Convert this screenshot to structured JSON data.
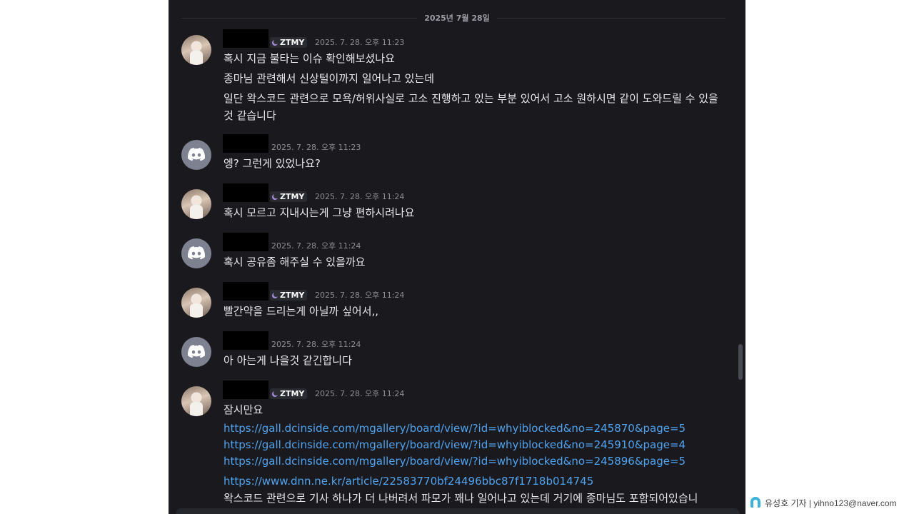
{
  "date_divider": "2025년 7월 28일",
  "messages": [
    {
      "avatar": "photo-avatar",
      "badge": "ZTMY",
      "timestamp": "2025. 7. 28. 오후 11:23",
      "lines": [
        "혹시 지금 불타는 이슈 확인해보셨나요",
        "종마님 관련해서 신상털이까지 일어나고 있는데",
        "일단 왁스코드 관련으로 모욕/허위사실로 고소 진행하고 있는 부분 있어서 고소 원하시면 같이 도와드릴 수 있을 것 같습니다"
      ]
    },
    {
      "avatar": "discord-avatar",
      "timestamp": "2025. 7. 28. 오후 11:23",
      "lines": [
        "엥? 그런게 있었나요?"
      ]
    },
    {
      "avatar": "photo-avatar",
      "badge": "ZTMY",
      "timestamp": "2025. 7. 28. 오후 11:24",
      "lines": [
        "혹시 모르고 지내시는게 그냥 편하시려나요"
      ]
    },
    {
      "avatar": "discord-avatar",
      "timestamp": "2025. 7. 28. 오후 11:24",
      "lines": [
        "혹시 공유좀 해주실 수 있을까요"
      ]
    },
    {
      "avatar": "photo-avatar",
      "badge": "ZTMY",
      "timestamp": "2025. 7. 28. 오후 11:24",
      "lines": [
        "빨간약을 드리는게 아닐까 싶어서,,"
      ]
    },
    {
      "avatar": "discord-avatar",
      "timestamp": "2025. 7. 28. 오후 11:24",
      "lines": [
        "아 아는게 나을것 같긴합니다"
      ]
    },
    {
      "avatar": "photo-avatar",
      "badge": "ZTMY",
      "timestamp": "2025. 7. 28. 오후 11:24",
      "lines": [
        "잠시만요"
      ],
      "links": [
        "https://gall.dcinside.com/mgallery/board/view/?id=whyiblocked&no=245870&page=5",
        "https://gall.dcinside.com/mgallery/board/view/?id=whyiblocked&no=245910&page=4",
        "https://gall.dcinside.com/mgallery/board/view/?id=whyiblocked&no=245896&page=5"
      ],
      "link2": "https://www.dnn.ne.kr/article/22583770bf24496bbc87f1718b014745",
      "tail": "왁스코드 관련으로 기사 하나가 더 나버려서 파모가 꽤나 일어나고 있는데 거기에 종마님도 포함되어있습니"
    }
  ],
  "credit": "유성호 기자 | yihno123@naver.com",
  "colors": {
    "background": "#1a1a1e",
    "text": "#e8e8ec",
    "link": "#4fa3f0",
    "timestamp": "#8d8e95"
  }
}
